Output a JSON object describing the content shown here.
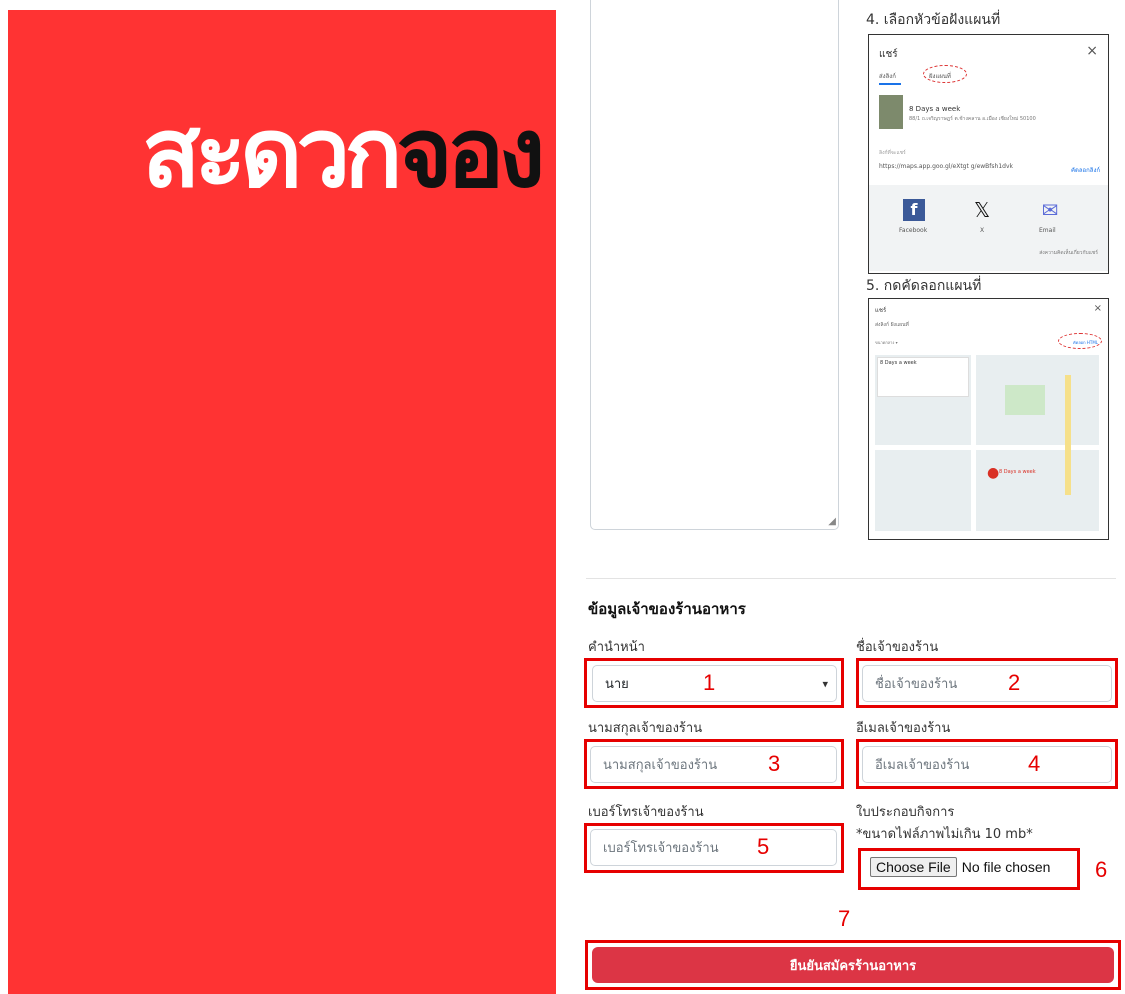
{
  "brand": {
    "logo_white": "สะดวก",
    "logo_black": "จอง",
    "panel_color": "#ff3333"
  },
  "instructions": {
    "step4": "4. เลือกหัวข้อฝังแผนที่",
    "step5": "5. กดคัดลอกแผนที่",
    "share_dialog": {
      "title": "แชร์",
      "tab_send": "ส่งลิงก์",
      "tab_embed": "ฝังแผนที่",
      "place_name": "8 Days a week",
      "address": "88/1 ถ.เจริญราษฎร์ ต.ช้างคลาน อ.เมือง เชียงใหม่ 50100",
      "link_label": "ลิงก์ที่จะแชร์",
      "link": "https://maps.app.goo.gl/eXtgt g/ewBfsh1dvk",
      "copy_link": "คัดลอกลิงก์",
      "facebook": "Facebook",
      "x": "X",
      "email": "Email",
      "footer": "ส่งความคิดเห็นเกี่ยวกับแชร์"
    },
    "map_dialog": {
      "title": "แชร์",
      "tabs": "ส่งลิงก์    ฝังแผนที่",
      "embed_size": "ขนาดกลาง ▾",
      "copy_html": "คัดลอก HTML",
      "place_name": "8 Days a week",
      "pin_label": "8 Days a week"
    }
  },
  "owner_section": {
    "title": "ข้อมูลเจ้าของร้านอาหาร",
    "prefix_label": "คำนำหน้า",
    "prefix_value": "นาย",
    "name_label": "ชื่อเจ้าของร้าน",
    "name_placeholder": "ชื่อเจ้าของร้าน",
    "surname_label": "นามสกุลเจ้าของร้าน",
    "surname_placeholder": "นามสกุลเจ้าของร้าน",
    "email_label": "อีเมลเจ้าของร้าน",
    "email_placeholder": "อีเมลเจ้าของร้าน",
    "phone_label": "เบอร์โทรเจ้าของร้าน",
    "phone_placeholder": "เบอร์โทรเจ้าของร้าน",
    "license_label": "ใบประกอบกิจการ",
    "license_note": "*ขนาดไฟล์ภาพไม่เกิน 10 mb*",
    "file_button": "Choose File",
    "file_status": "No file chosen",
    "submit_label": "ยืนยันสมัครร้านอาหาร"
  },
  "annotations": {
    "n1": "1",
    "n2": "2",
    "n3": "3",
    "n4": "4",
    "n5": "5",
    "n6": "6",
    "n7": "7"
  }
}
